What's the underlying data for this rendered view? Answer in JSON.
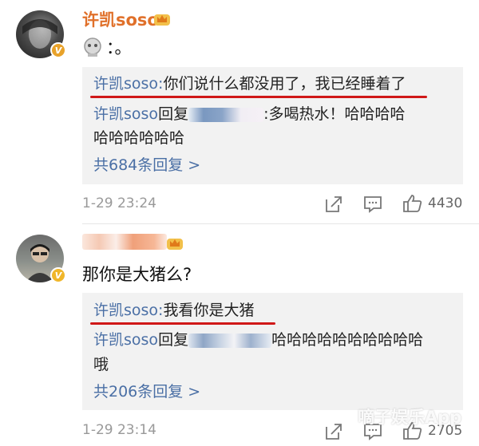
{
  "comments": [
    {
      "author": "许凯soso",
      "text": "：。",
      "replies": {
        "highlight": {
          "author": "许凯soso:",
          "text": "你们说什么都没用了，我已经睡着了"
        },
        "second": {
          "author": "许凯soso",
          "reply_word": "回复",
          "text1": ":多喝热水！哈哈哈哈",
          "text2": "哈哈哈哈哈哈"
        },
        "more_link": "共684条回复 >"
      },
      "time": "1-29 23:24",
      "likes": "4430"
    },
    {
      "author": "",
      "text": "那你是大猪么?",
      "replies": {
        "highlight": {
          "author": "许凯soso:",
          "text": "我看你是大猪"
        },
        "second": {
          "author": "许凯soso",
          "reply_word": "回复",
          "text1": "哈哈哈哈哈哈哈哈哈哈",
          "text2": "哦"
        },
        "more_link": "共206条回复 >"
      },
      "time": "1-29 23:14",
      "likes": "2705"
    }
  ],
  "watermark": "嘀子娱乐App",
  "colors": {
    "username": "#e0702a",
    "link": "#4a6fa5",
    "highlight_underline": "#d01818",
    "meta": "#999999"
  }
}
